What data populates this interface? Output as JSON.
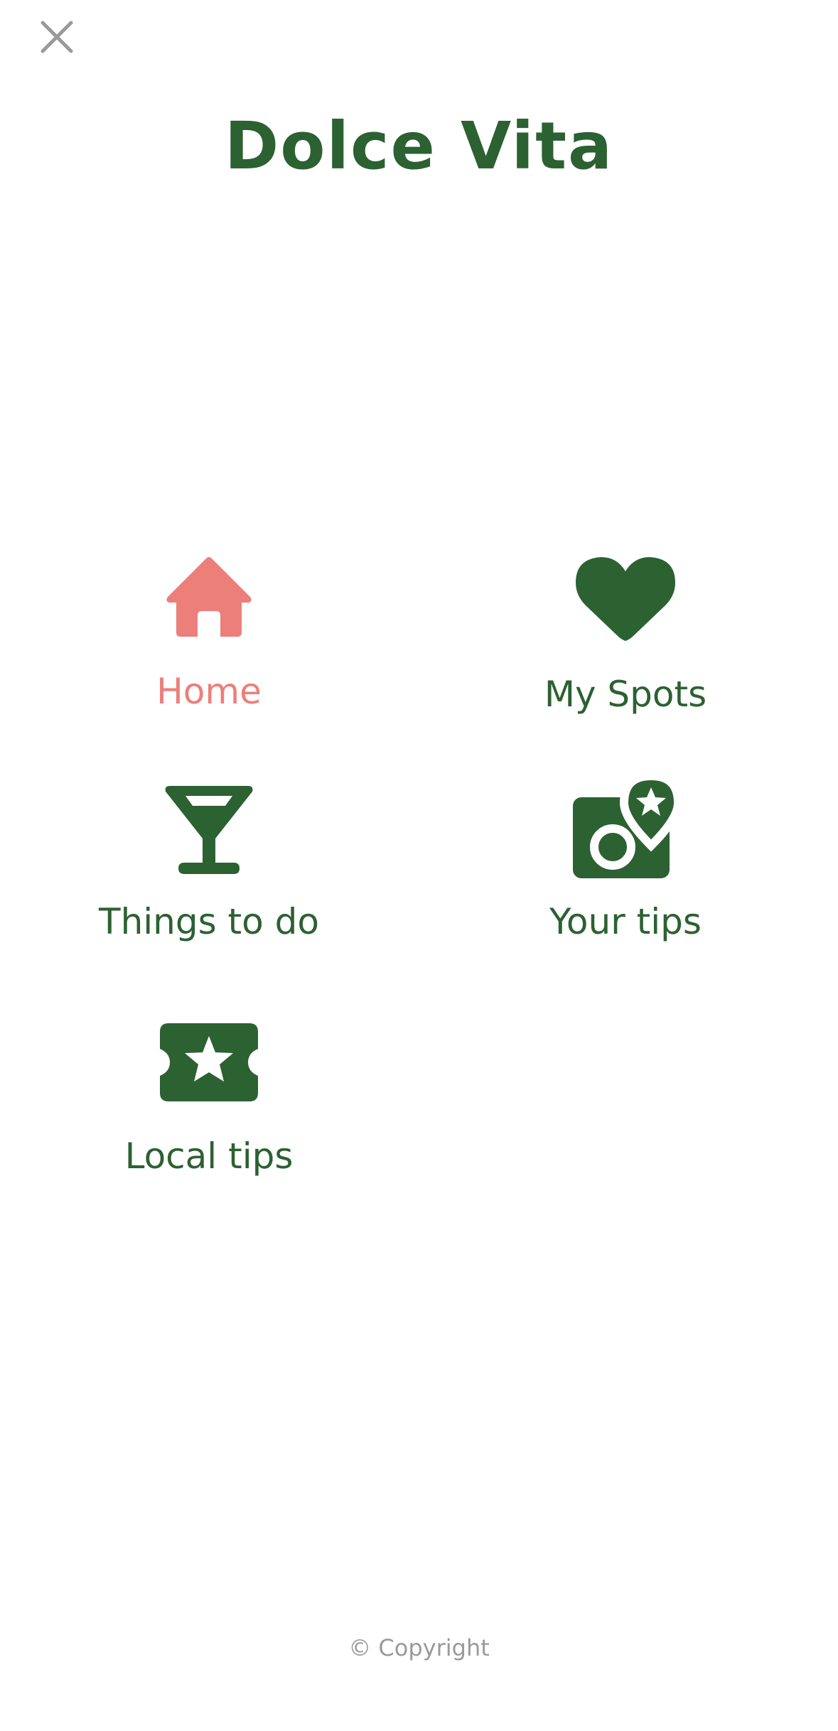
{
  "header": {
    "close_icon": "close-icon",
    "title": "Dolce Vita"
  },
  "colors": {
    "brand_green": "#2c6132",
    "active_coral": "#ec7f7a",
    "close_gray": "#9a9a9a",
    "footer_gray": "#9a9a9a"
  },
  "menu": {
    "active_item": "Home",
    "items": [
      {
        "label": "Home",
        "icon": "home-icon"
      },
      {
        "label": "My Spots",
        "icon": "heart-icon"
      },
      {
        "label": "Things to do",
        "icon": "cocktail-icon"
      },
      {
        "label": "Your tips",
        "icon": "photo-pin-star-icon"
      },
      {
        "label": "Local tips",
        "icon": "ticket-star-icon"
      }
    ]
  },
  "footer": {
    "text": "© Copyright"
  }
}
